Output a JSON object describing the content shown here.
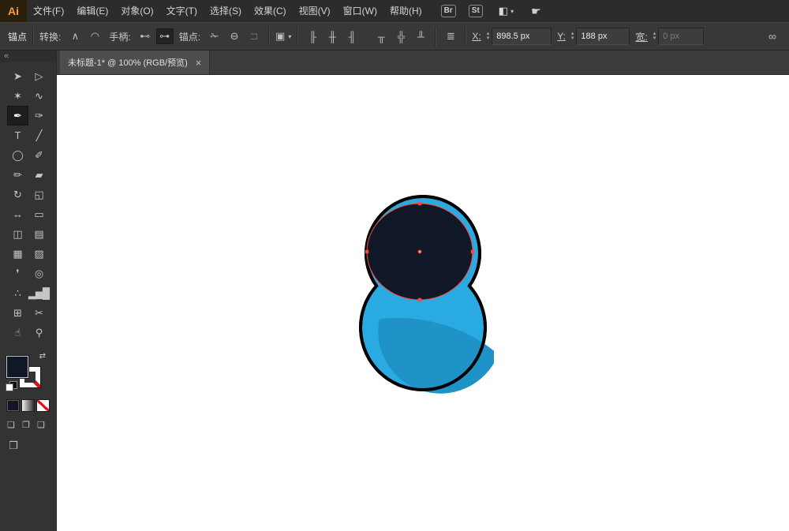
{
  "window": {
    "logo_text": "Ai"
  },
  "menubar": {
    "items": [
      {
        "name": "menu-file",
        "label": "文件(F)"
      },
      {
        "name": "menu-edit",
        "label": "编辑(E)"
      },
      {
        "name": "menu-object",
        "label": "对象(O)"
      },
      {
        "name": "menu-type",
        "label": "文字(T)"
      },
      {
        "name": "menu-select",
        "label": "选择(S)"
      },
      {
        "name": "menu-effect",
        "label": "效果(C)"
      },
      {
        "name": "menu-view",
        "label": "视图(V)"
      },
      {
        "name": "menu-window",
        "label": "窗口(W)"
      },
      {
        "name": "menu-help",
        "label": "帮助(H)"
      }
    ],
    "bridge_button": "Br",
    "stock_button": "St",
    "workspace_glyph": "◧",
    "chevron_glyph": "▾",
    "touch_glyph": "☛"
  },
  "controlbar": {
    "context_label": "锚点",
    "convert_label": "转换:",
    "handles_label": "手柄:",
    "anchors_label": "锚点:",
    "convert_icons": [
      {
        "name": "convert-corner-icon",
        "glyph": "∧"
      },
      {
        "name": "convert-smooth-icon",
        "glyph": "◠"
      }
    ],
    "handle_icons": [
      {
        "name": "hide-handles-icon",
        "glyph": "⊷"
      },
      {
        "name": "show-handles-icon",
        "glyph": "⊶",
        "pressed": true
      }
    ],
    "anchor_icons": [
      {
        "name": "cut-path-icon",
        "glyph": "✁"
      },
      {
        "name": "delete-anchor-icon",
        "glyph": "⊖"
      },
      {
        "name": "connect-path-icon",
        "glyph": "⊐",
        "disabled": true
      }
    ],
    "transform_dropdown": {
      "glyph": "▣",
      "chevron": "▾"
    },
    "align_icons": [
      {
        "name": "align-left-icon",
        "glyph": "╟"
      },
      {
        "name": "align-h-center-icon",
        "glyph": "╫"
      },
      {
        "name": "align-right-icon",
        "glyph": "╢"
      },
      {
        "name": "align-top-icon",
        "glyph": "╥"
      },
      {
        "name": "align-v-center-icon",
        "glyph": "╬"
      },
      {
        "name": "align-bottom-icon",
        "glyph": "╨"
      }
    ],
    "distribute_glyph": "≣",
    "spin_up": "▴",
    "spin_down": "▾",
    "x_label": "X:",
    "x_value": "898.5 px",
    "y_label": "Y:",
    "y_value": "188 px",
    "width_label": "宽:",
    "width_value": "0 px",
    "link_icon_glyph": "∞"
  },
  "tabbar": {
    "title": "未标题-1* @ 100% (RGB/预览)",
    "close": "×"
  },
  "toolbar": {
    "collapse": "«",
    "tools": [
      {
        "name": "selection-tool",
        "glyph": "➤"
      },
      {
        "name": "direct-selection-tool",
        "glyph": "▷"
      },
      {
        "name": "magic-wand-tool",
        "glyph": "✶"
      },
      {
        "name": "lasso-tool",
        "glyph": "∿"
      },
      {
        "name": "pen-tool",
        "glyph": "✒",
        "selected": true
      },
      {
        "name": "curvature-tool",
        "glyph": "✑"
      },
      {
        "name": "type-tool",
        "glyph": "T"
      },
      {
        "name": "line-segment-tool",
        "glyph": "╱"
      },
      {
        "name": "ellipse-tool",
        "glyph": "◯"
      },
      {
        "name": "paintbrush-tool",
        "glyph": "✐"
      },
      {
        "name": "pencil-tool",
        "glyph": "✏"
      },
      {
        "name": "eraser-tool",
        "glyph": "▰"
      },
      {
        "name": "rotate-tool",
        "glyph": "↻"
      },
      {
        "name": "scale-tool",
        "glyph": "◱"
      },
      {
        "name": "width-tool",
        "glyph": "↔"
      },
      {
        "name": "free-transform-tool",
        "glyph": "▭"
      },
      {
        "name": "shape-builder-tool",
        "glyph": "◫"
      },
      {
        "name": "perspective-grid-tool",
        "glyph": "▤"
      },
      {
        "name": "mesh-tool",
        "glyph": "▦"
      },
      {
        "name": "gradient-tool",
        "glyph": "▨"
      },
      {
        "name": "eyedropper-tool",
        "glyph": "❜"
      },
      {
        "name": "blend-tool",
        "glyph": "◎"
      },
      {
        "name": "symbol-sprayer-tool",
        "glyph": "∴"
      },
      {
        "name": "column-graph-tool",
        "glyph": "▂▅█"
      },
      {
        "name": "artboard-tool",
        "glyph": "⊞"
      },
      {
        "name": "slice-tool",
        "glyph": "✂"
      },
      {
        "name": "hand-tool",
        "glyph": "☝"
      },
      {
        "name": "zoom-tool",
        "glyph": "⚲"
      }
    ],
    "swap_glyph": "⇄",
    "draw_modes": [
      {
        "name": "draw-normal-icon",
        "glyph": "❏"
      },
      {
        "name": "draw-behind-icon",
        "glyph": "❐"
      },
      {
        "name": "draw-inside-icon",
        "glyph": "❑"
      }
    ],
    "screen_mode_glyph": "❒"
  },
  "canvas": {
    "shape": {
      "body_color": "#29aae1",
      "shade_color": "#1f93c8",
      "hole_color": "#101827",
      "outline_color": "#000000",
      "anchor_color": "#ff4438"
    }
  }
}
